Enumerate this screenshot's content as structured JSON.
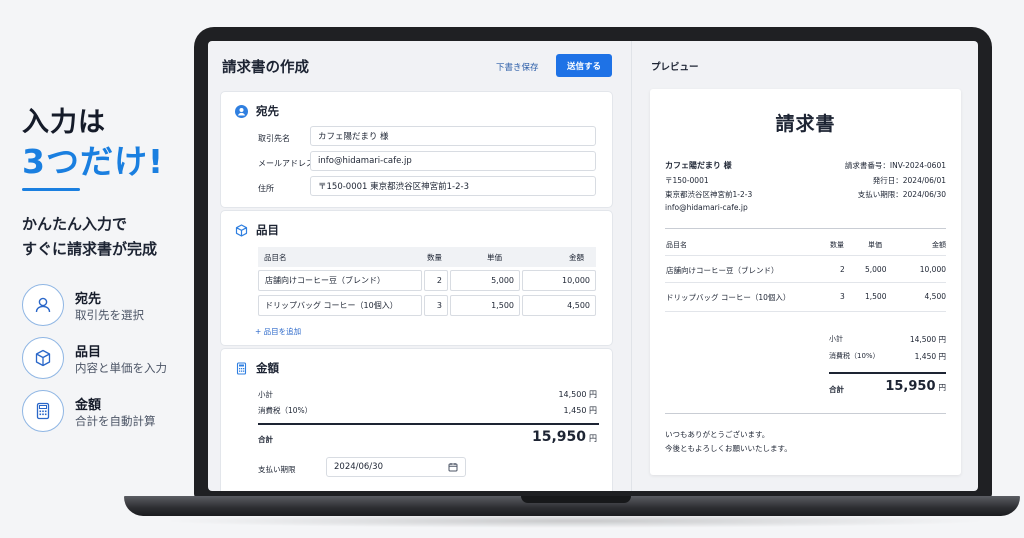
{
  "promo": {
    "headline_line1": "入力は",
    "headline_line2": "3つだけ!",
    "subtitle_line1": "かんたん入力で",
    "subtitle_line2": "すぐに請求書が完成",
    "features": [
      {
        "title": "宛先",
        "desc": "取引先を選択",
        "icon": "person-icon"
      },
      {
        "title": "品目",
        "desc": "内容と単価を入力",
        "icon": "box-icon"
      },
      {
        "title": "金額",
        "desc": "合計を自動計算",
        "icon": "calculator-icon"
      }
    ]
  },
  "editor": {
    "title": "請求書の作成",
    "draft_label": "下書き保存",
    "send_label": "送信する",
    "recipient": {
      "heading": "宛先",
      "name_label": "取引先名",
      "name_value": "カフェ陽だまり 様",
      "email_label": "メールアドレス",
      "email_value": "info@hidamari-cafe.jp",
      "address_label": "住所",
      "address_value": "〒150-0001 東京都渋谷区神宮前1-2-3"
    },
    "items": {
      "heading": "品目",
      "columns": [
        "品目名",
        "数量",
        "単価",
        "金額"
      ],
      "rows": [
        {
          "name": "店舗向けコーヒー豆（ブレンド）",
          "qty": "2",
          "price": "5,000",
          "amount": "10,000"
        },
        {
          "name": "ドリップバッグ コーヒー（10個入）",
          "qty": "3",
          "price": "1,500",
          "amount": "4,500"
        }
      ],
      "add_label": "+ 品目を追加"
    },
    "totals": {
      "heading": "金額",
      "subtotal_label": "小計",
      "subtotal_value": "14,500 円",
      "tax_label": "消費税（10%）",
      "tax_value": "1,450 円",
      "total_label": "合計",
      "total_value": "15,950",
      "total_unit": "円",
      "due_label": "支払い期限",
      "due_value": "2024/06/30"
    }
  },
  "preview": {
    "heading": "プレビュー",
    "doc_title": "請求書",
    "client_name": "カフェ陽だまり 様",
    "client_zip": "〒150-0001",
    "client_address": "東京都渋谷区神宮前1-2-3",
    "client_email": "info@hidamari-cafe.jp",
    "invoice_no": "請求書番号：INV-2024-0601",
    "issue_date": "発行日：2024/06/01",
    "due_date": "支払い期限：2024/06/30",
    "columns": [
      "品目名",
      "数量",
      "単価",
      "金額"
    ],
    "rows": [
      {
        "name": "店舗向けコーヒー豆（ブレンド）",
        "qty": "2",
        "price": "5,000",
        "amount": "10,000"
      },
      {
        "name": "ドリップバッグ コーヒー（10個入）",
        "qty": "3",
        "price": "1,500",
        "amount": "4,500"
      }
    ],
    "subtotal_label": "小計",
    "subtotal_value": "14,500 円",
    "tax_label": "消費税（10%）",
    "tax_value": "1,450 円",
    "total_label": "合計",
    "total_value": "15,950",
    "total_unit": "円",
    "note_line1": "いつもありがとうございます。",
    "note_line2": "今後ともよろしくお願いいたします。"
  },
  "colors": {
    "accent": "#1a7fe0",
    "button": "#1e72e6",
    "link": "#2a67c9"
  }
}
